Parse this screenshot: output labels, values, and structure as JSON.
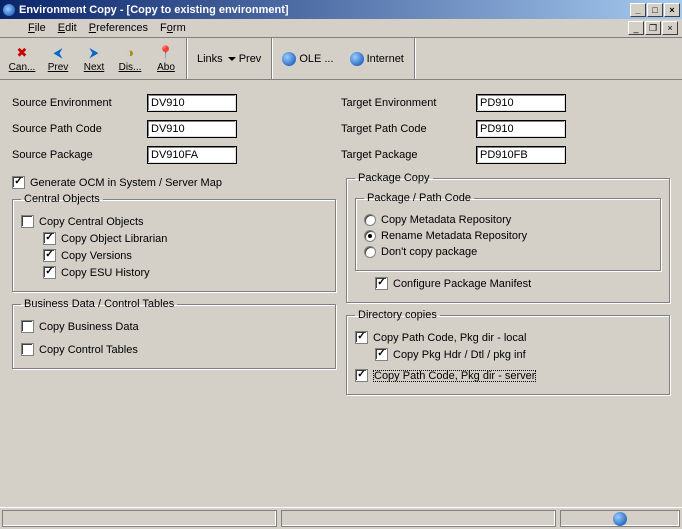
{
  "window": {
    "title": "Environment Copy - [Copy to existing environment]"
  },
  "menu": {
    "file": "File",
    "edit": "Edit",
    "preferences": "Preferences",
    "form": "Form"
  },
  "toolbar": {
    "cancel": "Can...",
    "prev": "Prev",
    "next": "Next",
    "display": "Dis...",
    "about": "Abo",
    "links": "Links",
    "prev_link": "Prev",
    "ole": "OLE ...",
    "internet": "Internet"
  },
  "fields": {
    "source_env_label": "Source Environment",
    "source_env_value": "DV910",
    "source_path_label": "Source Path Code",
    "source_path_value": "DV910",
    "source_pkg_label": "Source Package",
    "source_pkg_value": "DV910FA",
    "target_env_label": "Target Environment",
    "target_env_value": "PD910",
    "target_path_label": "Target Path Code",
    "target_path_value": "PD910",
    "target_pkg_label": "Target Package",
    "target_pkg_value": "PD910FB"
  },
  "options": {
    "generate_ocm": "Generate OCM in System / Server Map",
    "central_objects_legend": "Central Objects",
    "copy_central_objects": "Copy Central Objects",
    "copy_object_librarian": "Copy Object Librarian",
    "copy_versions": "Copy Versions",
    "copy_esu_history": "Copy ESU History",
    "business_legend": "Business Data / Control Tables",
    "copy_business_data": "Copy Business Data",
    "copy_control_tables": "Copy Control Tables",
    "package_copy_legend": "Package Copy",
    "package_path_legend": "Package / Path Code",
    "radio_copy_meta": "Copy Metadata Repository",
    "radio_rename_meta": "Rename Metadata Repository",
    "radio_dont_copy": "Don't copy package",
    "configure_manifest": "Configure Package Manifest",
    "directory_copies_legend": "Directory copies",
    "copy_path_local": "Copy Path Code, Pkg dir - local",
    "copy_pkg_hdr": "Copy Pkg Hdr / Dtl / pkg inf",
    "copy_path_server": "Copy Path Code, Pkg dir - server"
  }
}
